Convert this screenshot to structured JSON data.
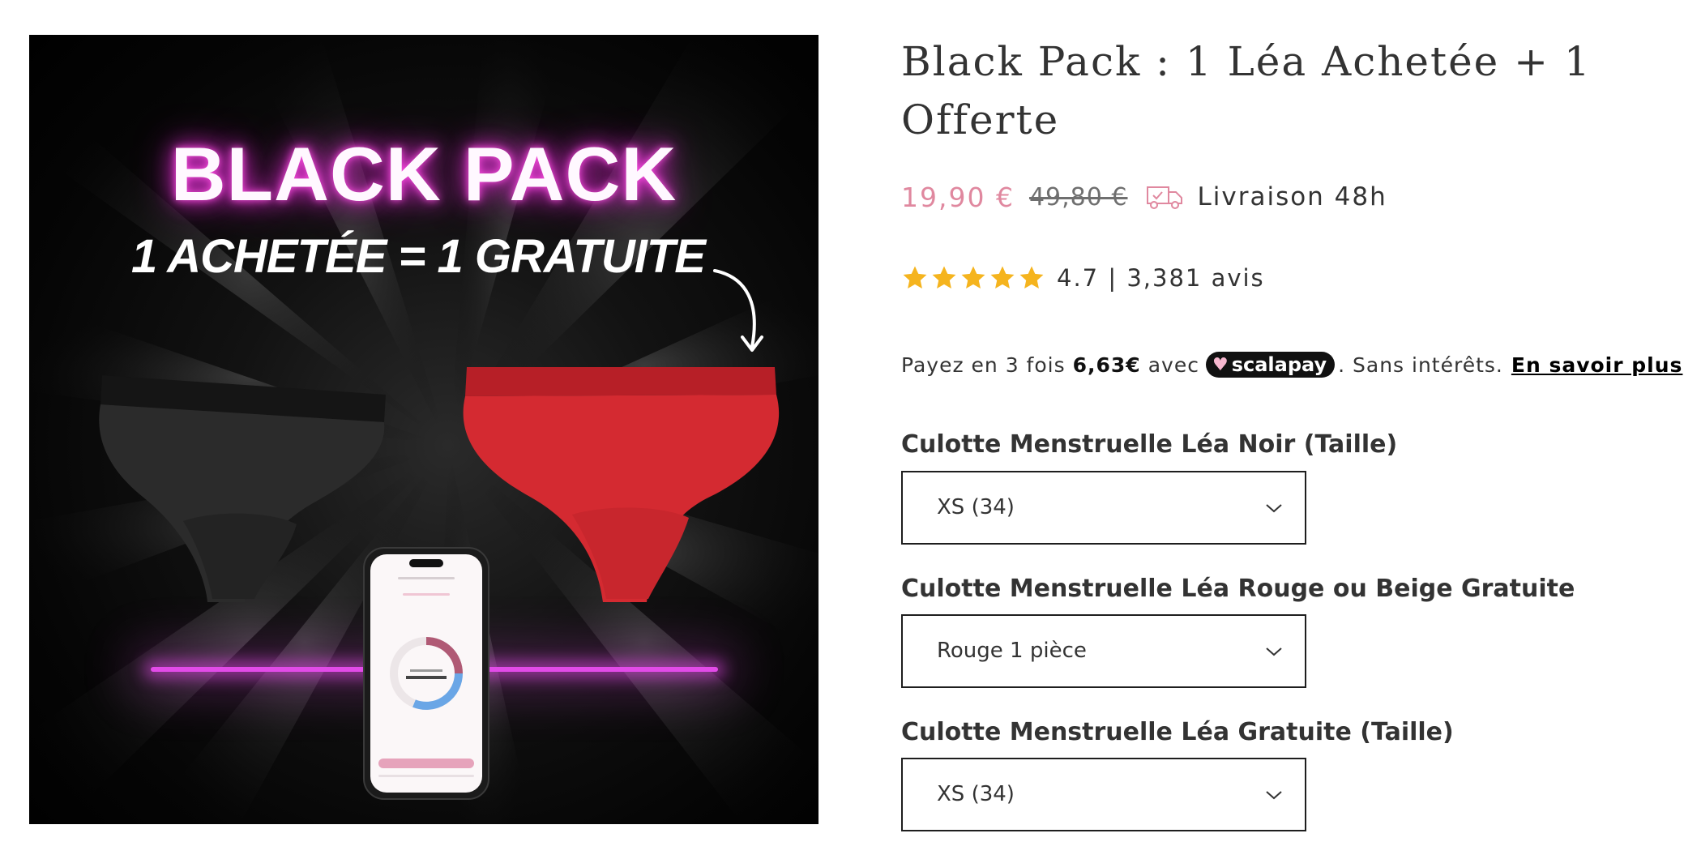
{
  "hero": {
    "headline": "BLACK PACK",
    "offer": "1 ACHETÉE = 1 GRATUITE",
    "alt": "Black Pack product image"
  },
  "product": {
    "title": "Black Pack : 1 Léa Achetée + 1 Offerte",
    "sale_price": "19,90 €",
    "compare_price": "49,80 €",
    "delivery": "Livraison 48h",
    "rating_stars": 5,
    "rating_text": "4.7 | 3,381 avis"
  },
  "payment": {
    "prefix": "Payez en 3 fois",
    "amount": "6,63€",
    "with": "avec",
    "provider": "scalapay",
    "suffix": ". Sans intérêts.",
    "link": "En savoir plus"
  },
  "variants": [
    {
      "label": "Culotte Menstruelle Léa Noir (Taille)",
      "value": "XS (34)"
    },
    {
      "label": "Culotte Menstruelle Léa Rouge ou Beige Gratuite",
      "value": "Rouge 1 pièce"
    },
    {
      "label": "Culotte Menstruelle Léa Gratuite (Taille)",
      "value": "XS (34)"
    }
  ],
  "colors": {
    "sale_price": "#e0889f",
    "neon_pink": "#e24be8",
    "star": "#f5b41e",
    "brief_black": "#2a2a2a",
    "brief_red": "#d42a31"
  },
  "icons": {
    "delivery": "truck-icon",
    "rating": "star-icon",
    "select": "chevron-down-icon",
    "scalapay": "heart-icon"
  }
}
